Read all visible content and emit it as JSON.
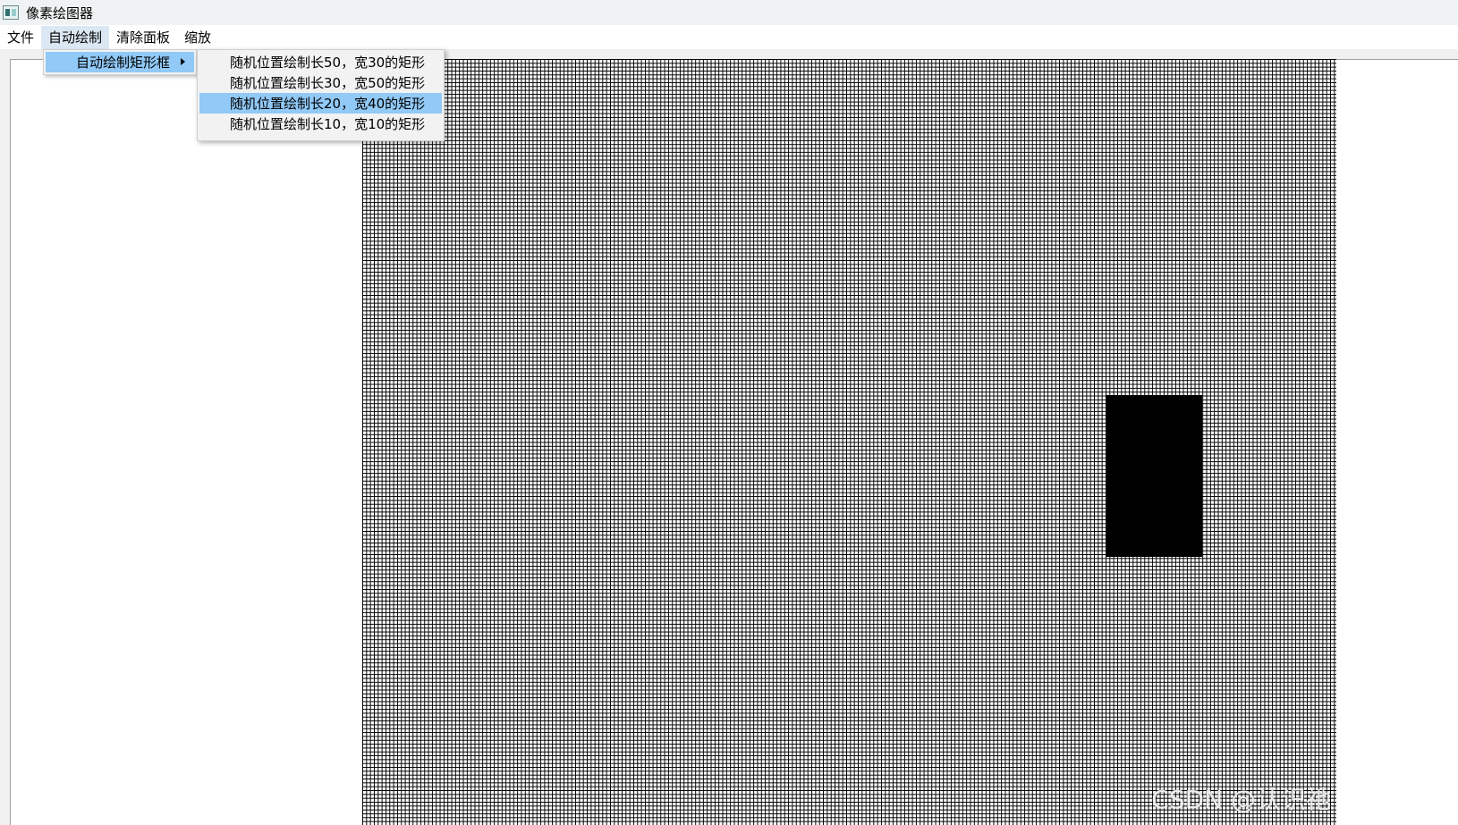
{
  "window": {
    "title": "像素绘图器"
  },
  "menubar": {
    "items": [
      {
        "label": "文件"
      },
      {
        "label": "自动绘制"
      },
      {
        "label": "清除面板"
      },
      {
        "label": "缩放"
      }
    ]
  },
  "dropdown": {
    "items": [
      {
        "label": "自动绘制矩形框",
        "has_submenu": true
      }
    ]
  },
  "submenu": {
    "items": [
      {
        "label": "随机位置绘制长50，宽30的矩形"
      },
      {
        "label": "随机位置绘制长30，宽50的矩形"
      },
      {
        "label": "随机位置绘制长20，宽40的矩形",
        "highlighted": true
      },
      {
        "label": "随机位置绘制长10，宽10的矩形"
      }
    ]
  },
  "watermark": {
    "text": "CSDN @认识祂"
  },
  "colors": {
    "highlight": "#91c9f7",
    "titlebar": "#f0f3f3",
    "grid": "#000000"
  }
}
